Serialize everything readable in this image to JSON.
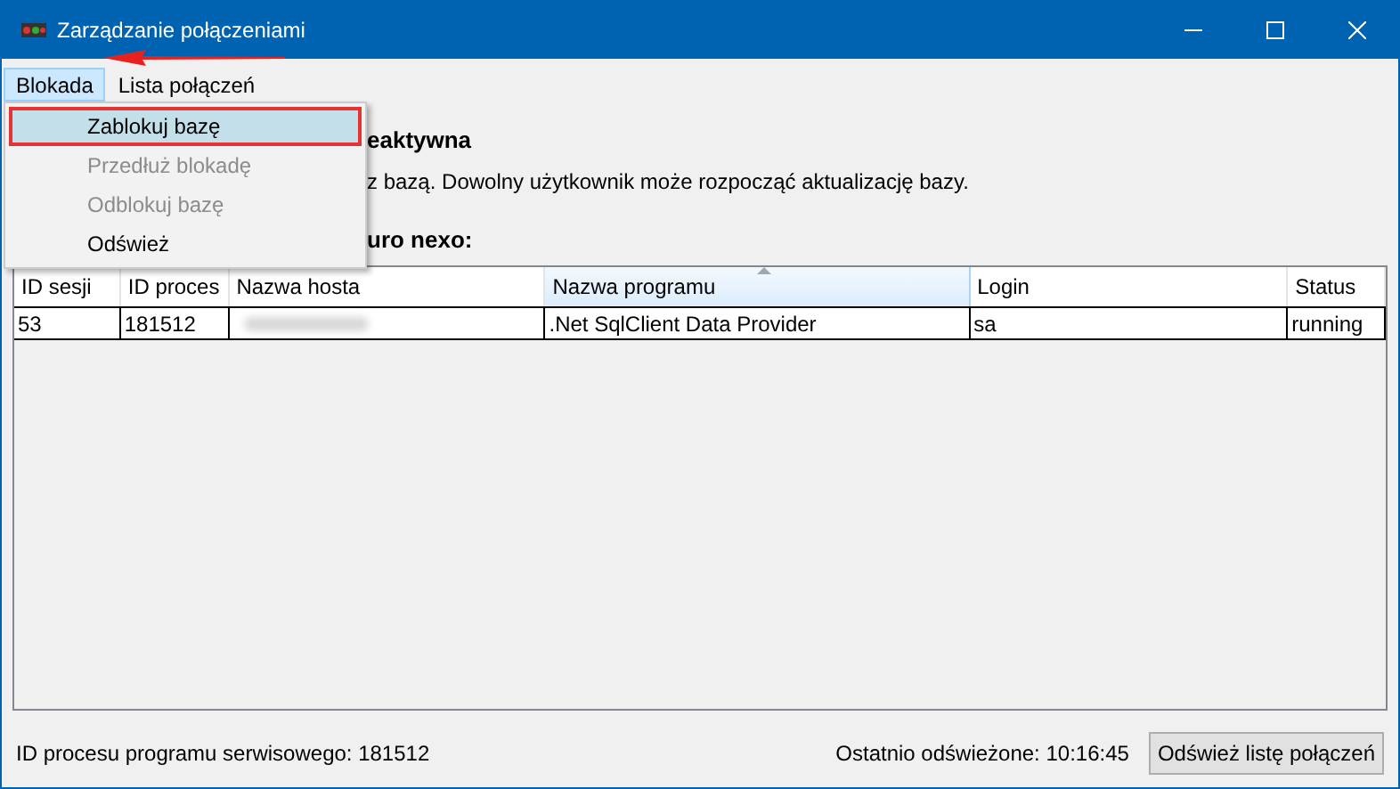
{
  "window": {
    "title": "Zarządzanie połączeniami"
  },
  "menu_bar": [
    {
      "label": "Blokada",
      "selected": true
    },
    {
      "label": "Lista połączeń",
      "selected": false
    }
  ],
  "dropdown": [
    {
      "label": "Zablokuj bazę",
      "selected": true,
      "disabled": false
    },
    {
      "label": "Przedłuż blokadę",
      "selected": false,
      "disabled": true
    },
    {
      "label": "Odblokuj bazę",
      "selected": false,
      "disabled": true
    },
    {
      "label": "Odśwież",
      "selected": false,
      "disabled": false
    }
  ],
  "heading": "eaktywna",
  "description": "z bazą. Dowolny użytkownik może rozpocząć aktualizację bazy.",
  "table_label": "uro nexo:",
  "table": {
    "columns": [
      {
        "label": "ID sesji",
        "sorted": false
      },
      {
        "label": "ID proces",
        "sorted": false
      },
      {
        "label": "Nazwa hosta",
        "sorted": false
      },
      {
        "label": "Nazwa programu",
        "sorted": true
      },
      {
        "label": "Login",
        "sorted": false
      },
      {
        "label": "Status",
        "sorted": false
      }
    ],
    "rows": [
      {
        "cells": [
          "53",
          "181512",
          null,
          ".Net SqlClient Data Provider",
          "sa",
          "running"
        ]
      }
    ]
  },
  "status_bar": {
    "process": "ID procesu programu serwisowego: 181512",
    "refreshed": "Ostatnio odświeżone: 10:16:45",
    "button": "Odśwież listę połączeń"
  }
}
